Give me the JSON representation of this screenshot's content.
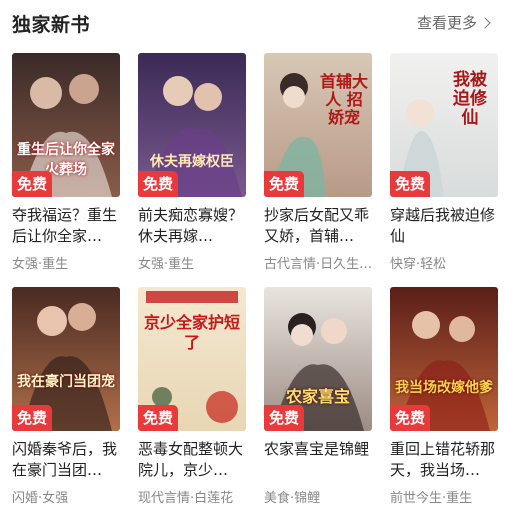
{
  "header": {
    "title": "独家新书",
    "more_label": "查看更多"
  },
  "badge_label": "免费",
  "books": [
    {
      "name": "夺我福运？重生后让你全家…",
      "tags": "女强·重生",
      "cover_text": "重生后让你全家火葬场",
      "cover_sub": "夺我福运？",
      "colors": [
        "#3a2a28",
        "#8a5c48"
      ]
    },
    {
      "name": "前夫痴恋寡嫂？休夫再嫁…",
      "tags": "女强·重生",
      "cover_text": "休夫再嫁权臣",
      "cover_sub": "前夫痴恋寡嫂",
      "colors": [
        "#3b2a55",
        "#7a5a90"
      ]
    },
    {
      "name": "抄家后女配又乖又娇，首辅…",
      "tags": "古代言情·日久生…",
      "cover_text": "首辅大人 招娇宠",
      "cover_sub": "抄家后女配又乖又娇",
      "colors": [
        "#d8c8b6",
        "#b89a86"
      ]
    },
    {
      "name": "穿越后我被迫修仙",
      "tags": "快穿·轻松",
      "cover_text": "我被迫修仙",
      "cover_sub": "穿越后",
      "colors": [
        "#f1f1ef",
        "#d9dcdc"
      ]
    },
    {
      "name": "闪婚秦爷后，我在豪门当团…",
      "tags": "闪婚·女强",
      "cover_text": "我在豪门当团宠",
      "cover_sub": "闪婚秦爷后",
      "colors": [
        "#4a2a22",
        "#b0704a"
      ]
    },
    {
      "name": "恶毒女配整顿大院儿，京少…",
      "tags": "现代言情·白莲花",
      "cover_text": "京少全家护短了",
      "cover_sub": "恶毒女配整顿大院儿",
      "colors": [
        "#f4e8d0",
        "#e8d6b4"
      ]
    },
    {
      "name": "农家喜宝是锦鲤",
      "tags": "美食·锦鲤",
      "cover_text": "农家喜宝",
      "cover_sub": "",
      "colors": [
        "#e9e4df",
        "#9c8c84"
      ]
    },
    {
      "name": "重回上错花轿那天，我当场…",
      "tags": "前世今生·重生",
      "cover_text": "我当场改嫁他爹",
      "cover_sub": "重回上错花轿那天",
      "colors": [
        "#5a1e18",
        "#c0643a"
      ]
    }
  ]
}
